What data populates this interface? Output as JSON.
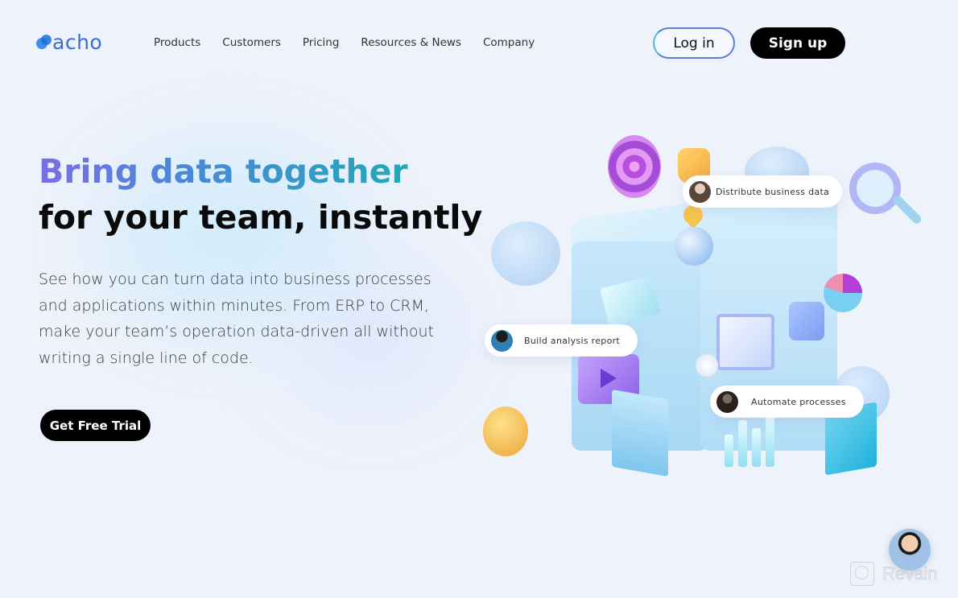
{
  "header": {
    "logo_text": "acho",
    "nav": [
      "Products",
      "Customers",
      "Pricing",
      "Resources & News",
      "Company"
    ],
    "login_label": "Log in",
    "signup_label": "Sign up"
  },
  "hero": {
    "title_line1": "Bring data together",
    "title_line2": "for your team, instantly",
    "description": "See how you can turn data into business processes and applications within minutes. From ERP to CRM, make your team’s operation data-driven all without writing a single line of code.",
    "cta_label": "Get Free Trial"
  },
  "illustration": {
    "chips": [
      {
        "label": "Distribute business data"
      },
      {
        "label": "Build analysis report"
      },
      {
        "label": "Automate processes"
      }
    ]
  },
  "watermark": {
    "text": "Revain"
  },
  "colors": {
    "background": "#eef2fb",
    "title_gradient_start": "#7a6ee8",
    "title_gradient_end": "#23a9b8",
    "button_dark": "#000000",
    "logo_blue": "#3c6ed0"
  }
}
